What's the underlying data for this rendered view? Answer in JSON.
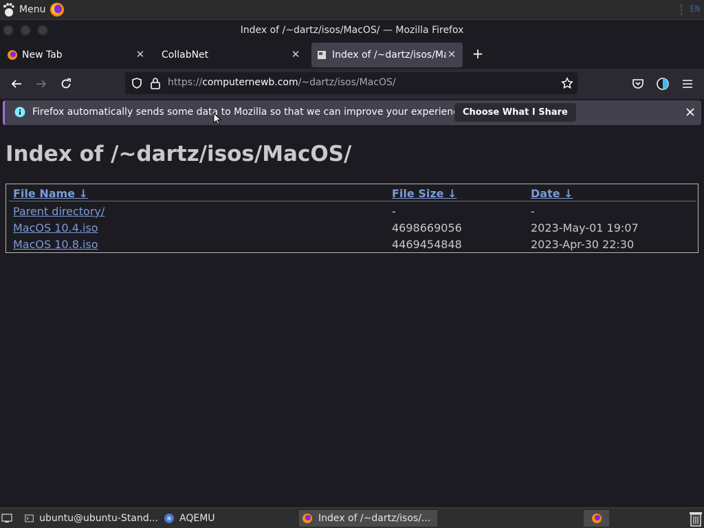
{
  "panel": {
    "menu_label": "Menu",
    "keyboard_layout": "EN"
  },
  "window": {
    "title": "Index of /~dartz/isos/MacOS/ — Mozilla Firefox"
  },
  "tabs": [
    {
      "label": "New Tab"
    },
    {
      "label": "CollabNet"
    },
    {
      "label": "Index of /~dartz/isos/Ma"
    }
  ],
  "urlbar": {
    "scheme": "https://",
    "host": "computernewb.com",
    "path": "/~dartz/isos/MacOS/"
  },
  "notification": {
    "message": "Firefox automatically sends some data to Mozilla so that we can improve your experience.",
    "button_label": "Choose What I Share"
  },
  "page": {
    "heading": "Index of /~dartz/isos/MacOS/",
    "columns": {
      "name": "File Name  ↓ ",
      "size": "File Size  ↓ ",
      "date": "Date  ↓ "
    },
    "rows": [
      {
        "name": "Parent directory/",
        "size": "-",
        "date": "-"
      },
      {
        "name": "MacOS 10.4.iso",
        "size": "4698669056",
        "date": "2023-May-01 19:07"
      },
      {
        "name": "MacOS 10.8.iso",
        "size": "4469454848",
        "date": "2023-Apr-30 22:30"
      }
    ]
  },
  "taskbar": {
    "items": [
      {
        "label": "ubuntu@ubuntu-Stand..."
      },
      {
        "label": "AQEMU"
      },
      {
        "label": "Index of /~dartz/isos/..."
      }
    ]
  },
  "colors": {
    "link": "#7b9bd6",
    "background": "#1c1b22",
    "accent": "#a071d8"
  }
}
